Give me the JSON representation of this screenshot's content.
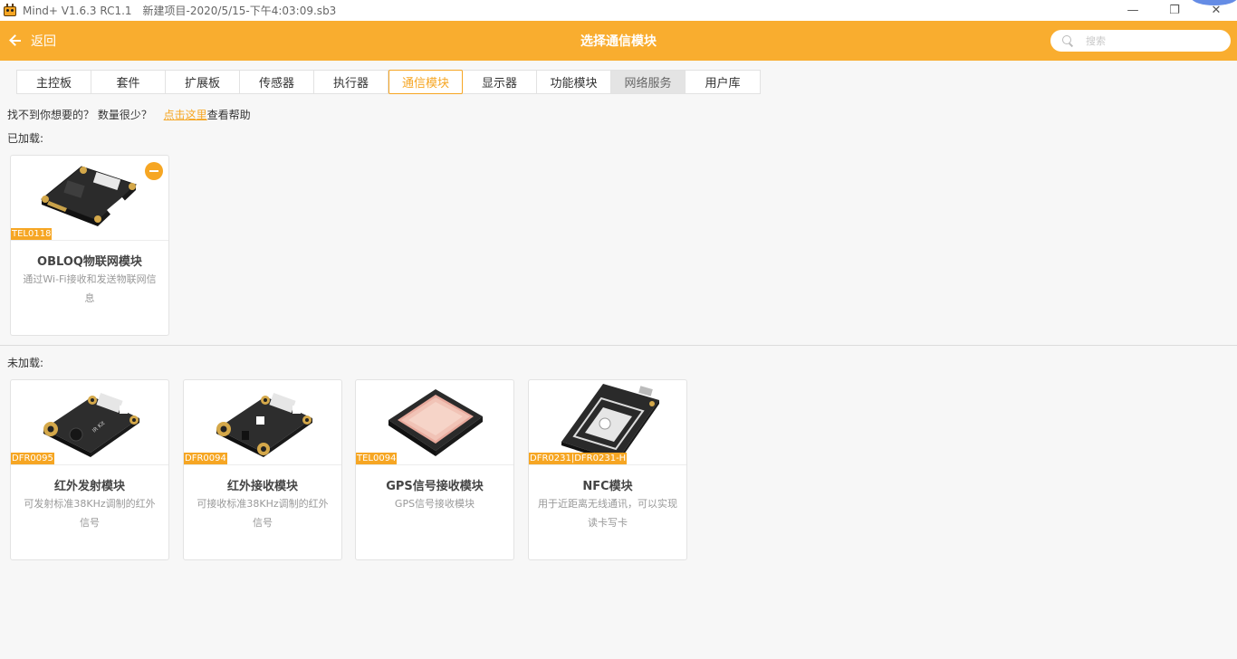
{
  "window": {
    "app_name": "Mind+ V1.6.3 RC1.1",
    "file_title": "新建项目-2020/5/15-下午4:03:09.sb3",
    "min_glyph": "—",
    "max_glyph": "❐",
    "close_glyph": "✕"
  },
  "header": {
    "back_label": "返回",
    "title": "选择通信模块",
    "search_placeholder": "搜索"
  },
  "colors": {
    "accent": "#f9ad2f",
    "tag": "#f6a623"
  },
  "tabs": [
    {
      "label": "主控板",
      "state": "normal"
    },
    {
      "label": "套件",
      "state": "normal"
    },
    {
      "label": "扩展板",
      "state": "normal"
    },
    {
      "label": "传感器",
      "state": "normal"
    },
    {
      "label": "执行器",
      "state": "normal"
    },
    {
      "label": "通信模块",
      "state": "active"
    },
    {
      "label": "显示器",
      "state": "normal"
    },
    {
      "label": "功能模块",
      "state": "normal"
    },
    {
      "label": "网络服务",
      "state": "hover"
    },
    {
      "label": "用户库",
      "state": "normal"
    }
  ],
  "help": {
    "prefix": "找不到你想要的？ 数量很少？",
    "link": "点击这里",
    "suffix": "查看帮助"
  },
  "loaded": {
    "label": "已加载:",
    "cards": [
      {
        "sku": "TEL0118",
        "name": "OBLOQ物联网模块",
        "desc": "通过Wi-Fi接收和发送物联网信息",
        "icon": "obloq-board-image"
      }
    ]
  },
  "unloaded": {
    "label": "未加载:",
    "cards": [
      {
        "sku": "DFR0095",
        "name": "红外发射模块",
        "desc": "可发射标准38KHz调制的红外信号",
        "icon": "ir-transmitter-board-image"
      },
      {
        "sku": "DFR0094",
        "name": "红外接收模块",
        "desc": "可接收标准38KHz调制的红外信号",
        "icon": "ir-receiver-board-image"
      },
      {
        "sku": "TEL0094",
        "name": "GPS信号接收模块",
        "desc": "GPS信号接收模块",
        "icon": "gps-antenna-image"
      },
      {
        "sku": "DFR0231|DFR0231-H",
        "name": "NFC模块",
        "desc": "用于近距离无线通讯，可以实现读卡写卡",
        "icon": "nfc-board-image"
      }
    ]
  }
}
